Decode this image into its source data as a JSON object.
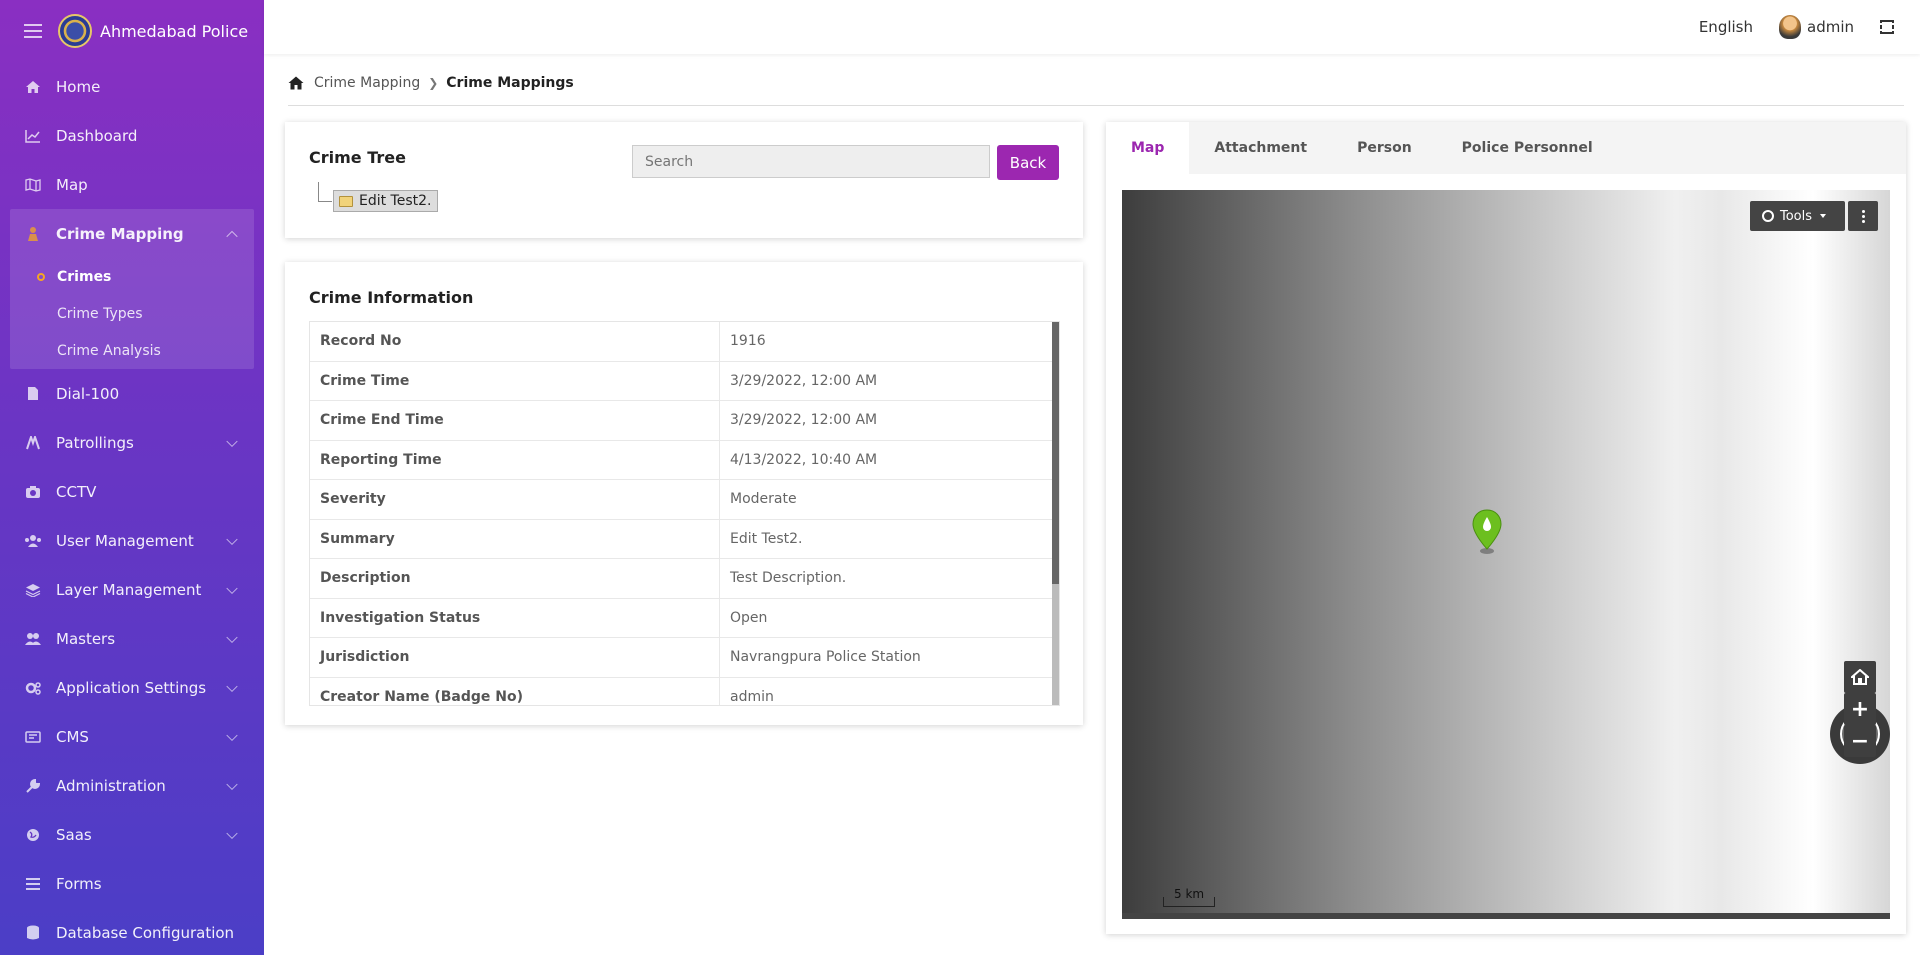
{
  "app": {
    "name": "Ahmedabad Police"
  },
  "topbar": {
    "language": "English",
    "username": "admin"
  },
  "sidebar": {
    "items": [
      {
        "label": "Home",
        "icon": "home-icon"
      },
      {
        "label": "Dashboard",
        "icon": "chart-line-icon"
      },
      {
        "label": "Map",
        "icon": "map-icon"
      },
      {
        "label": "Crime Mapping",
        "icon": "crime-icon",
        "expanded": true
      },
      {
        "label": "Dial-100",
        "icon": "file-icon"
      },
      {
        "label": "Patrollings",
        "icon": "patrol-icon"
      },
      {
        "label": "CCTV",
        "icon": "camera-icon"
      },
      {
        "label": "User Management",
        "icon": "users-icon"
      },
      {
        "label": "Layer Management",
        "icon": "layers-icon"
      },
      {
        "label": "Masters",
        "icon": "group-icon"
      },
      {
        "label": "Application Settings",
        "icon": "cogs-icon"
      },
      {
        "label": "CMS",
        "icon": "cms-icon"
      },
      {
        "label": "Administration",
        "icon": "wrench-icon"
      },
      {
        "label": "Saas",
        "icon": "globe-icon"
      },
      {
        "label": "Forms",
        "icon": "list-icon"
      },
      {
        "label": "Database Configuration",
        "icon": "database-icon"
      }
    ],
    "crime_mapping_sub": [
      {
        "label": "Crimes",
        "active": true
      },
      {
        "label": "Crime Types",
        "active": false
      },
      {
        "label": "Crime Analysis",
        "active": false
      }
    ]
  },
  "breadcrumb": {
    "parent": "Crime Mapping",
    "current": "Crime Mappings"
  },
  "crime_tree": {
    "title": "Crime Tree",
    "search_placeholder": "Search",
    "back_label": "Back",
    "node_label": "Edit Test2."
  },
  "crime_info": {
    "title": "Crime Information",
    "rows": [
      {
        "key": "Record No",
        "value": "1916"
      },
      {
        "key": "Crime Time",
        "value": "3/29/2022, 12:00 AM"
      },
      {
        "key": "Crime End Time",
        "value": "3/29/2022, 12:00 AM"
      },
      {
        "key": "Reporting Time",
        "value": "4/13/2022, 10:40 AM"
      },
      {
        "key": "Severity",
        "value": "Moderate"
      },
      {
        "key": "Summary",
        "value": "Edit Test2."
      },
      {
        "key": "Description",
        "value": "Test Description."
      },
      {
        "key": "Investigation Status",
        "value": "Open"
      },
      {
        "key": "Jurisdiction",
        "value": "Navrangpura Police Station"
      },
      {
        "key": "Creator Name (Badge No)",
        "value": "admin"
      }
    ]
  },
  "map_panel": {
    "tabs": [
      "Map",
      "Attachment",
      "Person",
      "Police Personnel"
    ],
    "active_tab": "Map",
    "tools_label": "Tools",
    "scale_label": "5 km",
    "accent_color": "#9c27b0",
    "marker_color": "#6cbf1f"
  }
}
